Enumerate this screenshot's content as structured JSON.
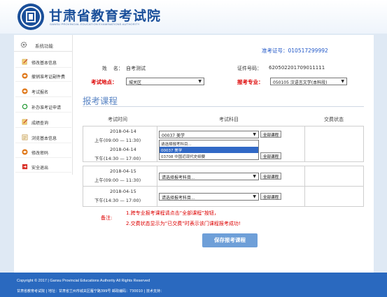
{
  "header": {
    "title": "甘肃省教育考试院",
    "subtitle": "GANSU PROVINCIAL EDUCATION EXAMINATIONS AUTHORITY"
  },
  "sidebar": {
    "heading": "系统功能",
    "items": [
      {
        "label": "修改基本信息",
        "icon": "edit-icon"
      },
      {
        "label": "撤销准考证副件费",
        "icon": "cap-icon"
      },
      {
        "label": "考试报名",
        "icon": "cap-icon"
      },
      {
        "label": "补办准考证申请",
        "icon": "refresh-icon"
      },
      {
        "label": "成绩查询",
        "icon": "edit-icon"
      },
      {
        "label": "浏览基本信息",
        "icon": "list-icon"
      },
      {
        "label": "修改密码",
        "icon": "cap-icon"
      },
      {
        "label": "安全退出",
        "icon": "exit-icon"
      }
    ]
  },
  "candidate": {
    "zkzh_label": "准考证号：",
    "zkzh_value": "010517299992",
    "name_label": "姓    名：",
    "name_value": "自考测试",
    "id_label": "证件号码：",
    "id_value": "620502201709011111",
    "site_label": "考试地点：",
    "site_value": "城关区",
    "major_label": "报考专业：",
    "major_value": "050105 汉语言文学(本科段)"
  },
  "section_title": "报考课程",
  "table": {
    "headers": [
      "考试时间",
      "考试科目",
      "交费状态"
    ],
    "rows": [
      {
        "date": "2018-04-14",
        "time": "上午(09:00 — 11:30)",
        "course": "00037 美学"
      },
      {
        "date": "2018-04-14",
        "time": "下午(14:30 — 17:00)",
        "course": "请选择报考科目..."
      },
      {
        "date": "2018-04-15",
        "time": "上午(09:00 — 11:30)",
        "course": "请选择报考科目..."
      },
      {
        "date": "2018-04-15",
        "time": "下午(14:30 — 17:00)",
        "course": "请选择报考科目..."
      }
    ],
    "all_button": "全部课程",
    "dropdown_options": [
      "请选择报考科目...",
      "00037 美学",
      "03708 中国近现代史纲要"
    ]
  },
  "notes": {
    "label": "备注:",
    "lines": [
      "1.跨专业报考课程请点击“全部课程”按钮，",
      "2.交费状态显示为“已交费”时表示该门课程报考成功!"
    ]
  },
  "save_button": "保存报考课程",
  "footer": {
    "copyright": "Copyright © 2017 | Gansu Provincial Educations Authority All Rights Reserved",
    "info": "甘肃省教育考试院 | 地址：甘肃省兰州市城关区雁宁路399号 邮政编码：730010 | 技术支持："
  }
}
